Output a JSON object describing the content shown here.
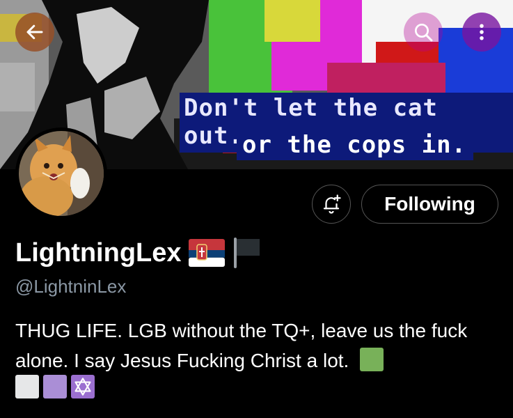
{
  "header": {
    "banner_text_line1": "Don't let the cat out.",
    "banner_text_line2": "or the cops in.",
    "back_icon": "arrow-left-icon",
    "search_icon": "search-icon",
    "more_icon": "more-vertical-icon"
  },
  "actions": {
    "notify_icon": "bell-plus-icon",
    "following_label": "Following"
  },
  "profile": {
    "display_name": "LightningLex",
    "handle": "@LightninLex",
    "flags": [
      "serbia-flag",
      "black-flag"
    ],
    "bio_text": "THUG LIFE. LGB without the TQ+, leave us the fuck alone. I say Jesus Fucking Christ a lot.",
    "bio_emojis": [
      "green-square",
      "white-square",
      "purple-square",
      "star-of-david"
    ]
  },
  "colors": {
    "handle": "#8b98a5",
    "green_square": "#78b159",
    "white_square": "#e6e7e8",
    "purple_square": "#aa8ed6"
  }
}
